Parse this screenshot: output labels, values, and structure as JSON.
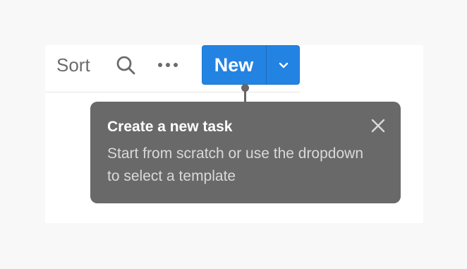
{
  "toolbar": {
    "sort_label": "Sort",
    "search_icon": "search-icon",
    "more_icon": "more-horizontal-icon",
    "new_label": "New",
    "dropdown_icon": "chevron-down-icon",
    "new_button_color": "#2383e2"
  },
  "tooltip": {
    "title": "Create a new task",
    "body": "Start from scratch or use the dropdown to select a template",
    "close_icon": "close-icon",
    "background": "#696969"
  }
}
